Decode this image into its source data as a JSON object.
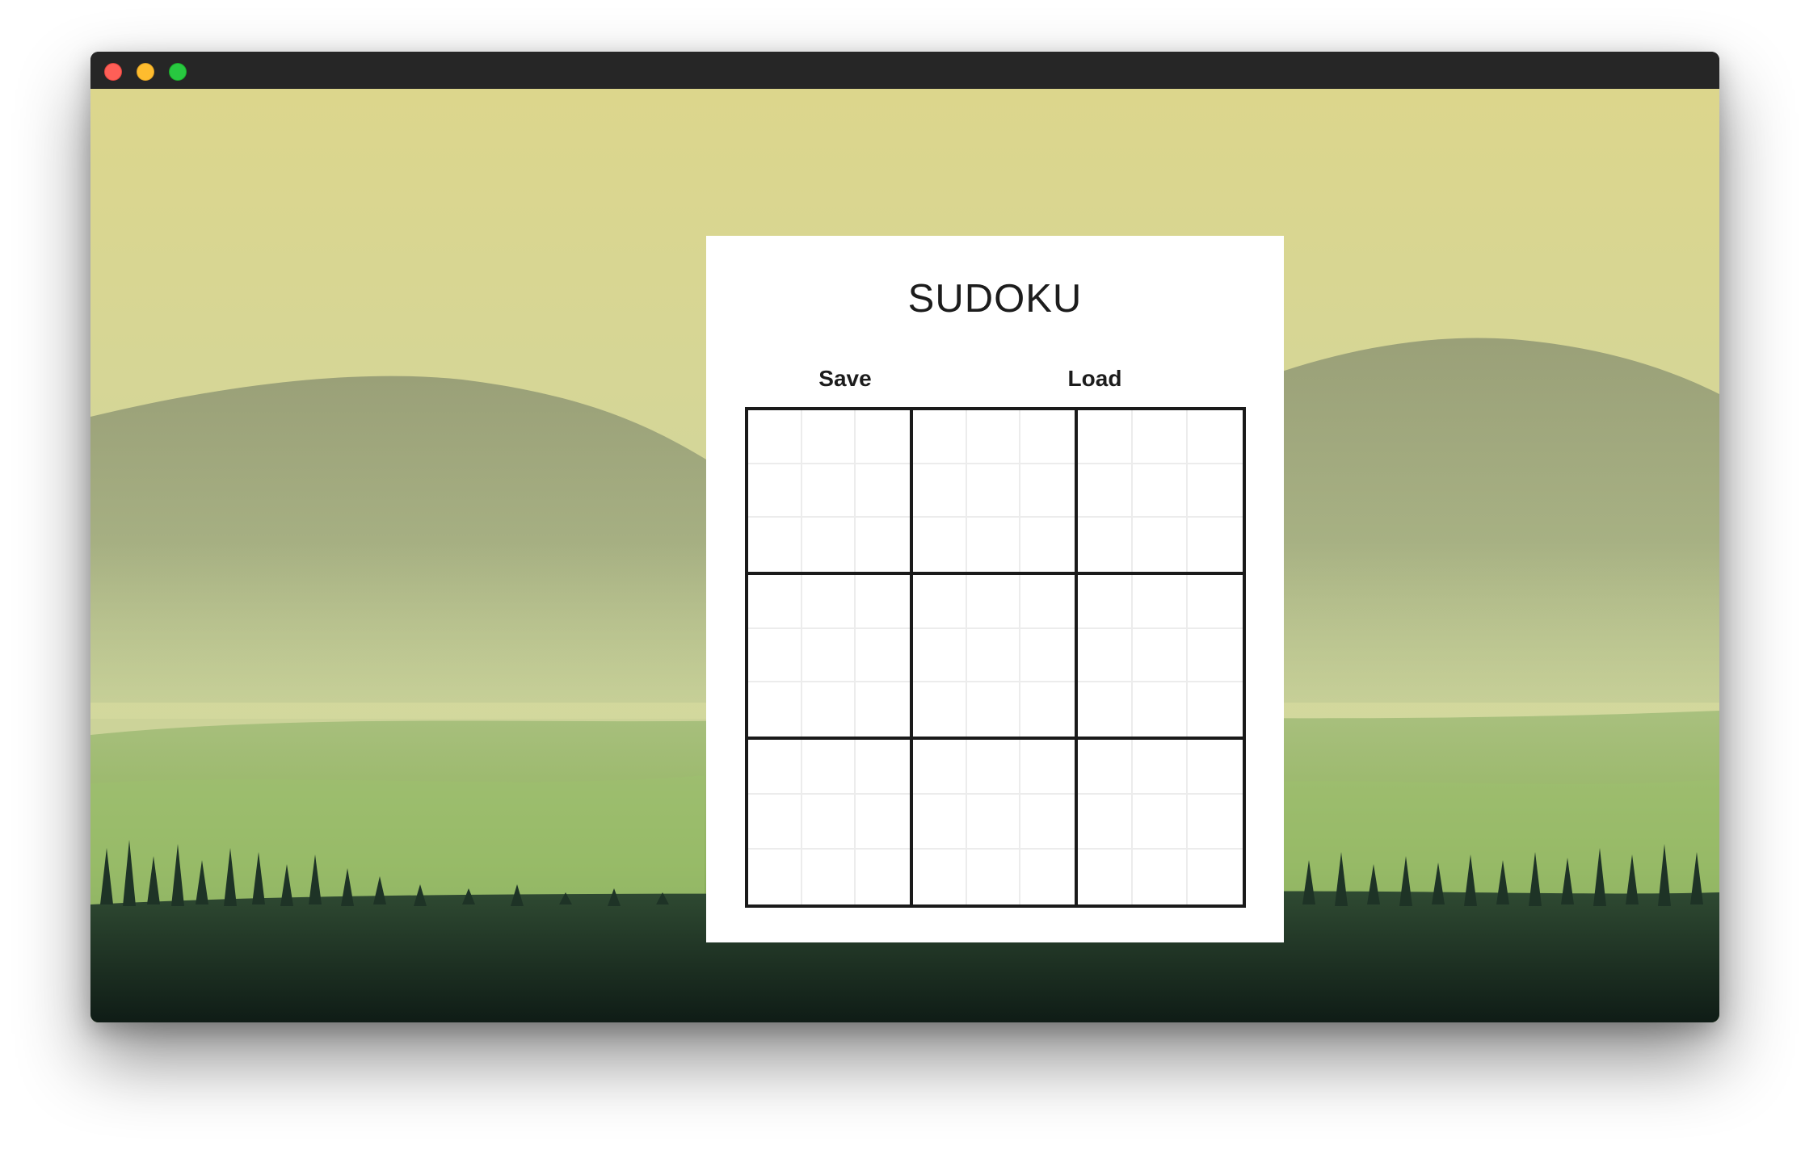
{
  "window": {
    "controls": [
      {
        "name": "close",
        "color": "#fe5f57"
      },
      {
        "name": "minimize",
        "color": "#febc2e"
      },
      {
        "name": "maximize",
        "color": "#28c840"
      }
    ]
  },
  "app": {
    "title": "SUDOKU",
    "save_label": "Save",
    "load_label": "Load"
  },
  "board": {
    "size": 9,
    "grid": [
      [
        "",
        "",
        "",
        "",
        "",
        "",
        "",
        "",
        ""
      ],
      [
        "",
        "",
        "",
        "",
        "",
        "",
        "",
        "",
        ""
      ],
      [
        "",
        "",
        "",
        "",
        "",
        "",
        "",
        "",
        ""
      ],
      [
        "",
        "",
        "",
        "",
        "",
        "",
        "",
        "",
        ""
      ],
      [
        "",
        "",
        "",
        "",
        "",
        "",
        "",
        "",
        ""
      ],
      [
        "",
        "",
        "",
        "",
        "",
        "",
        "",
        "",
        ""
      ],
      [
        "",
        "",
        "",
        "",
        "",
        "",
        "",
        "",
        ""
      ],
      [
        "",
        "",
        "",
        "",
        "",
        "",
        "",
        "",
        ""
      ],
      [
        "",
        "",
        "",
        "",
        "",
        "",
        "",
        "",
        ""
      ]
    ]
  },
  "colors": {
    "sky": "#d8d796",
    "hills": "#8f9c73",
    "meadow": "#86a85a",
    "trees": "#1e3326"
  }
}
